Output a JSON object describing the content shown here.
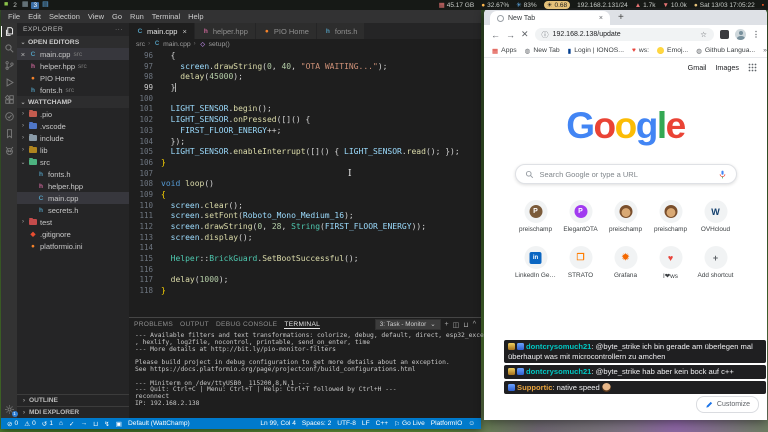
{
  "topbar": {
    "left": [
      {
        "type": "icon",
        "glyph": "■",
        "color": "#8bc34a",
        "name": "app-icon"
      },
      {
        "type": "ws",
        "text": "2",
        "active": false
      },
      {
        "type": "icon",
        "glyph": "▦",
        "color": "#90a4ae",
        "name": "window-icon"
      },
      {
        "type": "ws",
        "text": "3",
        "active": true
      },
      {
        "type": "icon",
        "glyph": "▤",
        "color": "#64b5f6",
        "name": "file-icon"
      }
    ],
    "stats": [
      {
        "glyph": "▦",
        "color": "#e57373",
        "text": "45.17 GB"
      },
      {
        "glyph": "●",
        "color": "#ffb74d",
        "text": "32.67%"
      },
      {
        "glyph": "✳",
        "color": "#64b5f6",
        "text": "83%"
      },
      {
        "glyph": "☀",
        "color": "#1b1b1b",
        "text": "0.68",
        "pill": true
      },
      {
        "glyph": "",
        "color": "",
        "text": "192.168.2.131/24"
      },
      {
        "glyph": "▲",
        "color": "#e57373",
        "text": "1.7k"
      },
      {
        "glyph": "▼",
        "color": "#e57373",
        "text": "10.0k"
      },
      {
        "glyph": "●",
        "color": "#e6c27a",
        "text": "Sat 13/03 17:05:22"
      },
      {
        "glyph": "▪",
        "color": "#ff5722",
        "text": ""
      }
    ]
  },
  "vscode": {
    "menus": [
      "File",
      "Edit",
      "Selection",
      "View",
      "Go",
      "Run",
      "Terminal",
      "Help"
    ],
    "activity": [
      {
        "icon": "files",
        "active": true
      },
      {
        "icon": "search"
      },
      {
        "icon": "scm"
      },
      {
        "icon": "debug"
      },
      {
        "icon": "extensions"
      },
      {
        "icon": "test"
      },
      {
        "icon": "bookmark"
      },
      {
        "icon": "pio"
      }
    ],
    "manage_badge": "1",
    "explorer": {
      "title": "EXPLORER",
      "more": "···",
      "open_editors_label": "OPEN EDITORS",
      "open_editors": [
        {
          "name": "main.cpp",
          "detail": "src",
          "icon": "cpp",
          "active": true
        },
        {
          "name": "helper.hpp",
          "detail": "src",
          "icon": "hpp"
        },
        {
          "name": "PIO Home",
          "detail": "",
          "icon": "pio"
        },
        {
          "name": "fonts.h",
          "detail": "src",
          "icon": "h"
        }
      ],
      "workspace_label": "WATTCHAMP",
      "tree": [
        {
          "name": ".pio",
          "kind": "folder",
          "color": "#c35b4e",
          "depth": 0,
          "chevron": "›"
        },
        {
          "name": ".vscode",
          "kind": "folder",
          "color": "#4f76c7",
          "depth": 0,
          "chevron": "›"
        },
        {
          "name": "include",
          "kind": "folder",
          "color": "#8a9ba8",
          "depth": 0,
          "chevron": "›"
        },
        {
          "name": "lib",
          "kind": "folder",
          "color": "#b0851f",
          "depth": 0,
          "chevron": "›"
        },
        {
          "name": "src",
          "kind": "folder",
          "color": "#4db380",
          "depth": 0,
          "chevron": "⌄"
        },
        {
          "name": "fonts.h",
          "kind": "file",
          "icon": "h",
          "depth": 1
        },
        {
          "name": "helper.hpp",
          "kind": "file",
          "icon": "hpp",
          "depth": 1
        },
        {
          "name": "main.cpp",
          "kind": "file",
          "icon": "cpp",
          "depth": 1,
          "selected": true
        },
        {
          "name": "secrets.h",
          "kind": "file",
          "icon": "h",
          "depth": 1
        },
        {
          "name": "test",
          "kind": "folder",
          "color": "#c34b4b",
          "depth": 0,
          "chevron": "›"
        },
        {
          "name": ".gitignore",
          "kind": "file",
          "icon": "git",
          "depth": 0
        },
        {
          "name": "platformio.ini",
          "kind": "file",
          "icon": "ini",
          "depth": 0
        }
      ],
      "bottom_sections": [
        "OUTLINE",
        "MDI EXPLORER"
      ]
    },
    "tabs": [
      {
        "name": "main.cpp",
        "icon": "cpp",
        "active": true,
        "close": "×"
      },
      {
        "name": "helper.hpp",
        "icon": "hpp"
      },
      {
        "name": "PIO Home",
        "icon": "pio"
      },
      {
        "name": "fonts.h",
        "icon": "h"
      }
    ],
    "breadcrumb": [
      {
        "label": "src"
      },
      {
        "label": "main.cpp",
        "icon": "cpp"
      },
      {
        "label": "setup()",
        "icon": "method"
      }
    ],
    "code": [
      {
        "n": 96,
        "tk": [
          [
            "  {",
            "p"
          ]
        ]
      },
      {
        "n": 97,
        "tk": [
          [
            "    ",
            "p"
          ],
          [
            "screen",
            "v"
          ],
          [
            ".",
            "p"
          ],
          [
            "drawString",
            "f"
          ],
          [
            "(",
            "p"
          ],
          [
            "0",
            "n"
          ],
          [
            ", ",
            "p"
          ],
          [
            "40",
            "n"
          ],
          [
            ", ",
            "p"
          ],
          [
            "\"OTA WAITING...\"",
            "s"
          ],
          [
            ");",
            "p"
          ]
        ]
      },
      {
        "n": 98,
        "tk": [
          [
            "    ",
            "p"
          ],
          [
            "delay",
            "f"
          ],
          [
            "(",
            "p"
          ],
          [
            "45000",
            "n"
          ],
          [
            ");",
            "p"
          ]
        ]
      },
      {
        "n": 99,
        "cur": true,
        "caret": true,
        "tk": [
          [
            "  }",
            "p"
          ]
        ]
      },
      {
        "n": 100,
        "tk": []
      },
      {
        "n": 101,
        "tk": [
          [
            "  ",
            "p"
          ],
          [
            "LIGHT_SENSOR",
            "v"
          ],
          [
            ".",
            "p"
          ],
          [
            "begin",
            "f"
          ],
          [
            "();",
            "p"
          ]
        ]
      },
      {
        "n": 102,
        "tk": [
          [
            "  ",
            "p"
          ],
          [
            "LIGHT_SENSOR",
            "v"
          ],
          [
            ".",
            "p"
          ],
          [
            "onPressed",
            "f"
          ],
          [
            "([]() {",
            "p"
          ]
        ]
      },
      {
        "n": 103,
        "tk": [
          [
            "    ",
            "p"
          ],
          [
            "FIRST_FLOOR_ENERGY",
            "v"
          ],
          [
            "++;",
            "p"
          ]
        ]
      },
      {
        "n": 104,
        "tk": [
          [
            "  });",
            "p"
          ]
        ]
      },
      {
        "n": 105,
        "tk": [
          [
            "  ",
            "p"
          ],
          [
            "LIGHT_SENSOR",
            "v"
          ],
          [
            ".",
            "p"
          ],
          [
            "enableInterrupt",
            "f"
          ],
          [
            "([]() { ",
            "p"
          ],
          [
            "LIGHT_SENSOR",
            "v"
          ],
          [
            ".",
            "p"
          ],
          [
            "read",
            "f"
          ],
          [
            "(); });",
            "p"
          ]
        ]
      },
      {
        "n": 106,
        "tk": [
          [
            "}",
            "b"
          ]
        ]
      },
      {
        "n": 107,
        "tk": []
      },
      {
        "n": 108,
        "tk": [
          [
            "void",
            "k"
          ],
          [
            " ",
            "p"
          ],
          [
            "loop",
            "f"
          ],
          [
            "()",
            "p"
          ]
        ]
      },
      {
        "n": 109,
        "tk": [
          [
            "{",
            "b"
          ]
        ]
      },
      {
        "n": 110,
        "tk": [
          [
            "  ",
            "p"
          ],
          [
            "screen",
            "v"
          ],
          [
            ".",
            "p"
          ],
          [
            "clear",
            "f"
          ],
          [
            "();",
            "p"
          ]
        ]
      },
      {
        "n": 111,
        "tk": [
          [
            "  ",
            "p"
          ],
          [
            "screen",
            "v"
          ],
          [
            ".",
            "p"
          ],
          [
            "setFont",
            "f"
          ],
          [
            "(",
            "p"
          ],
          [
            "Roboto_Mono_Medium_16",
            "v"
          ],
          [
            ");",
            "p"
          ]
        ]
      },
      {
        "n": 112,
        "tk": [
          [
            "  ",
            "p"
          ],
          [
            "screen",
            "v"
          ],
          [
            ".",
            "p"
          ],
          [
            "drawString",
            "f"
          ],
          [
            "(",
            "p"
          ],
          [
            "0",
            "n"
          ],
          [
            ", ",
            "p"
          ],
          [
            "28",
            "n"
          ],
          [
            ", ",
            "p"
          ],
          [
            "String",
            "t"
          ],
          [
            "(",
            "p"
          ],
          [
            "FIRST_FLOOR_ENERGY",
            "v"
          ],
          [
            "));",
            "p"
          ]
        ]
      },
      {
        "n": 113,
        "tk": [
          [
            "  ",
            "p"
          ],
          [
            "screen",
            "v"
          ],
          [
            ".",
            "p"
          ],
          [
            "display",
            "f"
          ],
          [
            "();",
            "p"
          ]
        ]
      },
      {
        "n": 114,
        "tk": []
      },
      {
        "n": 115,
        "tk": [
          [
            "  ",
            "p"
          ],
          [
            "Helper",
            "t"
          ],
          [
            "::",
            "p"
          ],
          [
            "BrickGuard",
            "t"
          ],
          [
            ".",
            "p"
          ],
          [
            "SetBootSuccessful",
            "f"
          ],
          [
            "();",
            "p"
          ]
        ]
      },
      {
        "n": 116,
        "tk": []
      },
      {
        "n": 117,
        "tk": [
          [
            "  ",
            "p"
          ],
          [
            "delay",
            "f"
          ],
          [
            "(",
            "p"
          ],
          [
            "1000",
            "n"
          ],
          [
            ");",
            "p"
          ]
        ]
      },
      {
        "n": 118,
        "tk": [
          [
            "}",
            "b"
          ]
        ]
      }
    ],
    "terminal": {
      "tabs": [
        "PROBLEMS",
        "OUTPUT",
        "DEBUG CONSOLE",
        "TERMINAL"
      ],
      "active_tab": "TERMINAL",
      "dropdown": "3: Task - Monitor",
      "controls": [
        "+",
        "◫",
        "⊔",
        "^"
      ],
      "lines": [
        "--- Available filters and text transformations: colorize, debug, default, direct, esp32_exception_decoder",
        ", hexlify, log2file, nocontrol, printable, send_on_enter, time",
        "--- More details at http://bit.ly/pio-monitor-filters",
        "",
        "Please build project in debug configuration to get more details about an exception.",
        "See https://docs.platformio.org/page/projectconf/build_configurations.html",
        "",
        "--- Miniterm on /dev/ttyUSB0  115200,8,N,1 ---",
        "--- Quit: Ctrl+C | Menu: Ctrl+T | Help: Ctrl+T followed by Ctrl+H ---",
        "reconnect",
        "IP: 192.168.2.138"
      ]
    },
    "statusbar": {
      "left": [
        {
          "g": "⊘",
          "t": "0"
        },
        {
          "g": "⚠",
          "t": "0"
        },
        {
          "g": "↺",
          "t": "1"
        },
        {
          "g": "⌂",
          "t": ""
        },
        {
          "g": "✓",
          "t": ""
        },
        {
          "g": "→",
          "t": ""
        },
        {
          "g": "⊔",
          "t": ""
        },
        {
          "g": "↯",
          "t": ""
        },
        {
          "g": "▣",
          "t": ""
        },
        {
          "g": "",
          "t": "Default (WattChamp)"
        }
      ],
      "right": [
        {
          "g": "",
          "t": "Ln 99, Col 4"
        },
        {
          "g": "",
          "t": "Spaces: 2"
        },
        {
          "g": "",
          "t": "UTF-8"
        },
        {
          "g": "",
          "t": "LF"
        },
        {
          "g": "",
          "t": "C++"
        },
        {
          "g": "⚐",
          "t": "Go Live"
        },
        {
          "g": "",
          "t": "PlatformIO"
        },
        {
          "g": "☺",
          "t": ""
        }
      ]
    }
  },
  "browser": {
    "tab_title": "New Tab",
    "url": "192.168.2.138/update",
    "bookmarks": [
      {
        "label": "Apps",
        "glyph": "▦",
        "color": "#d93025"
      },
      {
        "label": "New Tab",
        "glyph": "◍",
        "color": "#5f6368"
      },
      {
        "label": "Login | IONOS...",
        "glyph": "▮",
        "color": "#003d8f"
      },
      {
        "label": "ws:",
        "glyph": "♥",
        "color": "#e8453c"
      },
      {
        "label": "Emoj...",
        "glyph": "smiley",
        "color": "#fbbc04"
      },
      {
        "label": "Github Langua...",
        "glyph": "◍",
        "color": "#5f6368"
      }
    ],
    "bookmarks_overflow": "»",
    "top_links": [
      "Gmail",
      "Images"
    ],
    "logo_letters": [
      {
        "ch": "G",
        "color": "#4285F4"
      },
      {
        "ch": "o",
        "color": "#EA4335"
      },
      {
        "ch": "o",
        "color": "#FBBC05"
      },
      {
        "ch": "g",
        "color": "#4285F4"
      },
      {
        "ch": "l",
        "color": "#34A853"
      },
      {
        "ch": "e",
        "color": "#EA4335"
      }
    ],
    "search_placeholder": "Search Google or type a URL",
    "shortcuts": [
      {
        "label": "preischamp",
        "kind": "disc",
        "bg": "#7b5b3a",
        "glyph": "P"
      },
      {
        "label": "ElegantOTA",
        "kind": "disc",
        "bg": "#a13bf0",
        "glyph": "P"
      },
      {
        "label": "preischamp",
        "kind": "monkey"
      },
      {
        "label": "preischamp",
        "kind": "monkey"
      },
      {
        "label": "OVHcloud",
        "kind": "glyph",
        "glyph": "W",
        "color": "#123f6d"
      },
      {
        "label": "LinkedIn Ger...",
        "kind": "linkedin",
        "glyph": "in"
      },
      {
        "label": "STRATO",
        "kind": "glyph",
        "glyph": "❒",
        "color": "#ff7d00"
      },
      {
        "label": "Grafana",
        "kind": "glyph",
        "glyph": "✹",
        "color": "#f46800"
      },
      {
        "label": "I❤ws",
        "kind": "glyph",
        "glyph": "♥",
        "color": "#e8453c"
      },
      {
        "label": "Add shortcut",
        "kind": "glyph",
        "glyph": "+",
        "color": "#5f6368"
      }
    ],
    "customize_label": "Customize"
  },
  "chat": {
    "messages": [
      {
        "badges": [
          "gold",
          "blue"
        ],
        "user": "dontcrysomuch21",
        "user_color": "#00c7c3",
        "text": "@byte_strike ich bin gerade am überlegen mal überhaupt was mit microcontrollern zu amchen",
        "emote": false
      },
      {
        "badges": [
          "gold",
          "blue"
        ],
        "user": "dontcrysomuch21",
        "user_color": "#00c7c3",
        "text": "@byte_strike hab aber kein bock auf c++",
        "emote": false
      },
      {
        "badges": [
          "blue"
        ],
        "user": "Supportic",
        "user_color": "#e8a33d",
        "text": "native speed",
        "emote": true
      }
    ]
  }
}
